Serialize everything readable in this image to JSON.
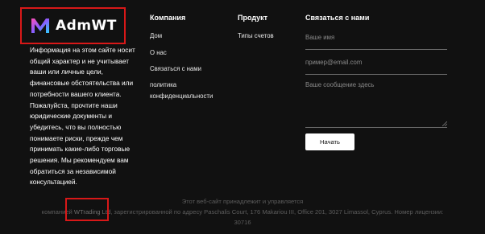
{
  "logo": {
    "text": "AdmWT",
    "highlight_color": "#d81818"
  },
  "about": {
    "disclaimer": "Информация на этом сайте носит общий характер и не учитывает ваши или личные цели, финансовые обстоятельства или потребности вашего клиента. Пожалуйста, прочтите наши юридические документы и убедитесь, что вы полностью понимаете риски, прежде чем принимать какие-либо торговые решения. Мы рекомендуем вам обратиться за независимой консультацией."
  },
  "company": {
    "title": "Компания",
    "links": [
      "Дом",
      "О нас",
      "Связаться с нами",
      "политика",
      "конфиденциальности"
    ]
  },
  "product": {
    "title": "Продукт",
    "links": [
      "Типы счетов"
    ]
  },
  "contact": {
    "title": "Связаться с нами",
    "name_placeholder": "Ваше имя",
    "email_placeholder": "пример@email.com",
    "message_placeholder": "Ваше сообщение здесь",
    "submit_label": "Начать"
  },
  "footer": {
    "line1": "Этот веб-сайт принадлежит и управляется",
    "line2_before": "компанией ",
    "company_name": "WTrading Ltd",
    "line2_after": ", зарегистрированной по адресу Paschalis Court, 176 Makariou III, Office 201, 3027 Limassol, Cyprus. Номер лицензии:",
    "license_number": "30716"
  }
}
